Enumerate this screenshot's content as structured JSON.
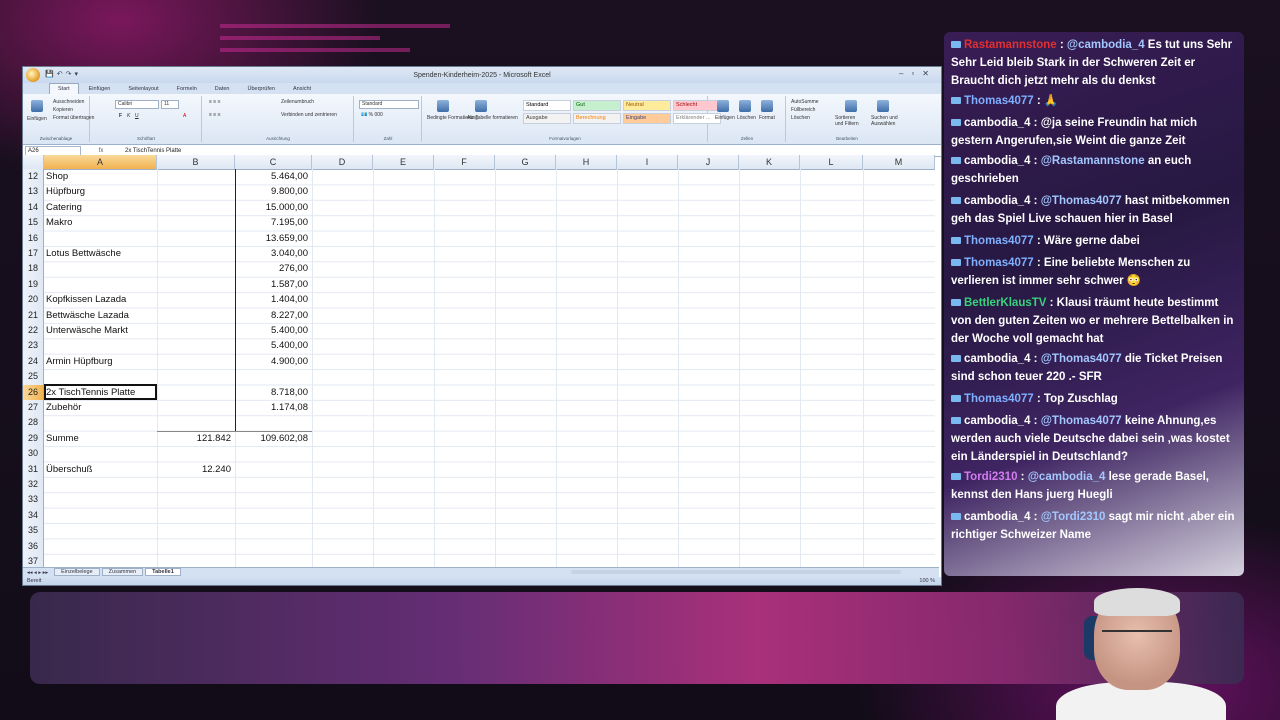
{
  "excel": {
    "window_title": "Spenden-Kinderheim-2025 - Microsoft Excel",
    "tabs": [
      "Start",
      "Einfügen",
      "Seitenlayout",
      "Formeln",
      "Daten",
      "Überprüfen",
      "Ansicht"
    ],
    "active_tab": "Start",
    "ribbon": {
      "clipboard": {
        "paste": "Einfügen",
        "cut": "Ausschneiden",
        "copy": "Kopieren",
        "format_painter": "Format übertragen",
        "label": "Zwischenablage"
      },
      "font": {
        "name": "Calibri",
        "size": "11",
        "label": "Schriftart"
      },
      "alignment": {
        "wrap": "Zeilenumbruch",
        "merge": "Verbinden und zentrieren",
        "label": "Ausrichtung"
      },
      "number": {
        "format": "Standard",
        "label": "Zahl"
      },
      "styles": {
        "cond_format": "Bedingte Formatierung",
        "as_table": "Als Tabelle formatieren",
        "cells": [
          {
            "label": "Standard",
            "bg": "#ffffff",
            "color": "#000000"
          },
          {
            "label": "Gut",
            "bg": "#c6efce",
            "color": "#006100"
          },
          {
            "label": "Neutral",
            "bg": "#ffeb9c",
            "color": "#9c5700"
          },
          {
            "label": "Schlecht",
            "bg": "#ffc7ce",
            "color": "#9c0006"
          },
          {
            "label": "Ausgabe",
            "bg": "#f2f2f2",
            "color": "#3f3f3f"
          },
          {
            "label": "Berechnung",
            "bg": "#f2f2f2",
            "color": "#fa7d00"
          },
          {
            "label": "Eingabe",
            "bg": "#ffcc99",
            "color": "#3f3f76"
          },
          {
            "label": "Erklärender ...",
            "bg": "#ffffff",
            "color": "#7f7f7f"
          }
        ],
        "label": "Formatvorlagen"
      },
      "cells_group": {
        "insert": "Einfügen",
        "delete": "Löschen",
        "format": "Format",
        "label": "Zellen"
      },
      "editing": {
        "autosum": "AutoSumme",
        "fill": "Füllbereich",
        "clear": "Löschen",
        "sort": "Sortieren und Filtern",
        "find": "Suchen und Auswählen",
        "label": "Bearbeiten"
      }
    },
    "name_box": "A26",
    "fx": "fx",
    "formula": "2x TischTennis Platte",
    "columns": [
      "A",
      "B",
      "C",
      "D",
      "E",
      "F",
      "G",
      "H",
      "I",
      "J",
      "K",
      "L",
      "M"
    ],
    "rows": [
      {
        "n": "12",
        "a": "Shop",
        "b": "",
        "c": "5.464,00"
      },
      {
        "n": "13",
        "a": "Hüpfburg",
        "b": "",
        "c": "9.800,00"
      },
      {
        "n": "14",
        "a": "Catering",
        "b": "",
        "c": "15.000,00"
      },
      {
        "n": "15",
        "a": "Makro",
        "b": "",
        "c": "7.195,00"
      },
      {
        "n": "16",
        "a": "",
        "b": "",
        "c": "13.659,00"
      },
      {
        "n": "17",
        "a": "Lotus Bettwäsche",
        "b": "",
        "c": "3.040,00"
      },
      {
        "n": "18",
        "a": "",
        "b": "",
        "c": "276,00"
      },
      {
        "n": "19",
        "a": "",
        "b": "",
        "c": "1.587,00"
      },
      {
        "n": "20",
        "a": "Kopfkissen Lazada",
        "b": "",
        "c": "1.404,00"
      },
      {
        "n": "21",
        "a": "Bettwäsche Lazada",
        "b": "",
        "c": "8.227,00"
      },
      {
        "n": "22",
        "a": "Unterwäsche Markt",
        "b": "",
        "c": "5.400,00"
      },
      {
        "n": "23",
        "a": "",
        "b": "",
        "c": "5.400,00"
      },
      {
        "n": "24",
        "a": "Armin Hüpfburg",
        "b": "",
        "c": "4.900,00"
      },
      {
        "n": "25",
        "a": "",
        "b": "",
        "c": ""
      },
      {
        "n": "26",
        "a": "2x TischTennis Platte",
        "b": "",
        "c": "8.718,00"
      },
      {
        "n": "27",
        "a": "Zubehör",
        "b": "",
        "c": "1.174,08"
      },
      {
        "n": "28",
        "a": "",
        "b": "",
        "c": ""
      },
      {
        "n": "29",
        "a": "Summe",
        "b": "121.842",
        "c": "109.602,08"
      },
      {
        "n": "30",
        "a": "",
        "b": "",
        "c": ""
      },
      {
        "n": "31",
        "a": "Überschuß",
        "b": "12.240",
        "c": ""
      },
      {
        "n": "32",
        "a": "",
        "b": "",
        "c": ""
      },
      {
        "n": "33",
        "a": "",
        "b": "",
        "c": ""
      },
      {
        "n": "34",
        "a": "",
        "b": "",
        "c": ""
      },
      {
        "n": "35",
        "a": "",
        "b": "",
        "c": ""
      },
      {
        "n": "36",
        "a": "",
        "b": "",
        "c": ""
      },
      {
        "n": "37",
        "a": "",
        "b": "",
        "c": ""
      }
    ],
    "selected_row": "26",
    "sheet_tabs": [
      "Einzelbelege",
      "Zusammen",
      "Tabelle1"
    ],
    "active_sheet": "Tabelle1",
    "status": "Bereit",
    "zoom": "100 %"
  },
  "chat": {
    "messages": [
      {
        "user": "Rastamannstone",
        "user_color": "#e03030",
        "text": "Es tut uns Sehr Sehr Leid bleib Stark in der Schweren Zeit er Braucht dich jetzt mehr als du denkst",
        "mention": "@cambodia_4"
      },
      {
        "user": "Thomas4077",
        "user_color": "#7fb0ff",
        "text": "🙏",
        "mention": ""
      },
      {
        "user": "cambodia_4",
        "user_color": "#ffffff",
        "text": "@ja seine Freundin hat mich gestern Angerufen,sie Weint die ganze Zeit",
        "mention": ""
      },
      {
        "user": "cambodia_4",
        "user_color": "#ffffff",
        "text": "an euch geschrieben",
        "mention": "@Rastamannstone"
      },
      {
        "user": "cambodia_4",
        "user_color": "#ffffff",
        "text": "hast mitbekommen geh das Spiel Live schauen hier in Basel",
        "mention": "@Thomas4077"
      },
      {
        "user": "Thomas4077",
        "user_color": "#7fb0ff",
        "text": "Wäre gerne dabei",
        "mention": ""
      },
      {
        "user": "Thomas4077",
        "user_color": "#7fb0ff",
        "text": "Eine beliebte Menschen zu verlieren ist immer sehr schwer 😳",
        "mention": ""
      },
      {
        "user": "BettlerKlausTV",
        "user_color": "#38d27a",
        "text": "Klausi träumt heute bestimmt von den guten Zeiten wo er mehrere Bettelbalken in der Woche voll gemacht hat",
        "mention": ""
      },
      {
        "user": "cambodia_4",
        "user_color": "#ffffff",
        "text": "die Ticket Preisen sind schon teuer 220 .- SFR",
        "mention": "@Thomas4077"
      },
      {
        "user": "Thomas4077",
        "user_color": "#7fb0ff",
        "text": "Top Zuschlag",
        "mention": ""
      },
      {
        "user": "cambodia_4",
        "user_color": "#ffffff",
        "text": "keine Ahnung,es werden auch viele Deutsche dabei sein ,was kostet ein Länderspiel in Deutschland?",
        "mention": "@Thomas4077"
      },
      {
        "user": "Tordi2310",
        "user_color": "#d37cf0",
        "text": "lese gerade Basel, kennst den Hans juerg Huegli",
        "mention": "@cambodia_4"
      },
      {
        "user": "cambodia_4",
        "user_color": "#ffffff",
        "text": "sagt mir nicht ,aber ein richtiger Schweizer Name",
        "mention": "@Tordi2310"
      }
    ]
  }
}
